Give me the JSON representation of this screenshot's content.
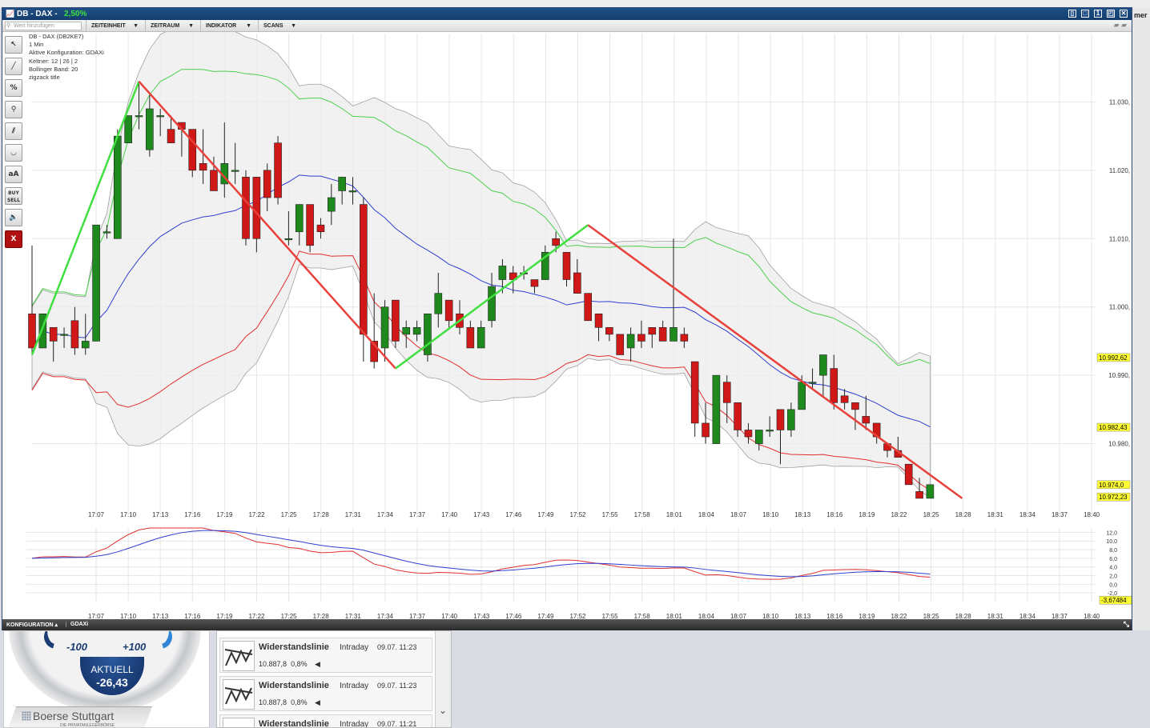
{
  "window": {
    "title": "DB - DAX -",
    "change": "2,50%",
    "accent": "#1f4f86"
  },
  "right_edge_text": "mer",
  "toolbar": {
    "search_placeholder": "Wert hinzufügen",
    "menus": [
      "ZEITEINHEIT",
      "ZEITRAUM",
      "INDIKATOR",
      "SCANS"
    ]
  },
  "tools": [
    "pointer-icon",
    "line-icon",
    "percent-icon",
    "zoom-icon",
    "parallel-lines-icon",
    "arc-icon",
    "text-icon",
    "buy-sell-icon",
    "sound-icon",
    "delete-icon"
  ],
  "tool_labels": [
    "↖",
    "╱",
    "%",
    "⚲",
    "⫽",
    "◡",
    "aA",
    "BUY SELL",
    "🔈",
    "X"
  ],
  "info": {
    "lines": [
      "DB - DAX (DB2KE7)",
      "1 Min",
      "Aktive Konfiguration: GDAXi",
      "Keltner: 12 | 26 | 2",
      "Bollinger Band: 20",
      "zigzack title"
    ]
  },
  "statusbar": {
    "config_label": "KONFIGURATION ▴",
    "config_name": "GDAXi"
  },
  "gauge": {
    "minus": "-100",
    "plus": "+100",
    "label": "AKTUELL",
    "value": "-26,43"
  },
  "logo": {
    "text": "Boerse Stuttgart",
    "sub": "DIE PRIVATANLEGERBÖRSE"
  },
  "signals": [
    {
      "title": "Widerstandslinie",
      "type": "Intraday",
      "date": "09.07. 11:23",
      "value": "10.887,8",
      "pct": "0,8%"
    },
    {
      "title": "Widerstandslinie",
      "type": "Intraday",
      "date": "09.07. 11:23",
      "value": "10.887,8",
      "pct": "0,8%"
    },
    {
      "title": "Widerstandslinie",
      "type": "Intraday",
      "date": "09.07. 11:21",
      "value": "",
      "pct": ""
    }
  ],
  "chart_data": {
    "type": "candlestick",
    "x_labels": [
      "17:07",
      "17:10",
      "17:13",
      "17:16",
      "17:19",
      "17:22",
      "17:25",
      "17:28",
      "17:31",
      "17:34",
      "17:37",
      "17:40",
      "17:43",
      "17:46",
      "17:49",
      "17:52",
      "17:55",
      "17:58",
      "18:01",
      "18:04",
      "18:07",
      "18:10",
      "18:13",
      "18:16",
      "18:19",
      "18:22",
      "18:25",
      "18:28",
      "18:31",
      "18:34",
      "18:37",
      "18:40"
    ],
    "y_ticks": [
      "11.030,",
      "11.020,",
      "11.010,",
      "11.000,",
      "10.990,",
      "10.980,"
    ],
    "y_range": [
      10970,
      11040
    ],
    "price_tags": [
      {
        "label": "10.992,62",
        "value": 10992.6,
        "color": "#ffff33"
      },
      {
        "label": "10.982,43",
        "value": 10982.4,
        "color": "#ffff33"
      },
      {
        "label": "10.974,0",
        "value": 10974.0,
        "color": "#ffff33"
      },
      {
        "label": "10.972,23",
        "value": 10972.2,
        "color": "#ffff33"
      }
    ],
    "ohlc": [
      [
        10999,
        11009,
        10993,
        10994
      ],
      [
        10994,
        10999,
        10994,
        10999
      ],
      [
        10997,
        10997,
        10992,
        10995
      ],
      [
        10996,
        10997,
        10994,
        10996
      ],
      [
        10998,
        11000,
        10993,
        10994
      ],
      [
        10994,
        10999,
        10993,
        10995
      ],
      [
        10995,
        11012,
        10995,
        11012
      ],
      [
        11011,
        11012,
        11010,
        11011
      ],
      [
        11010,
        11026,
        11010,
        11025
      ],
      [
        11024,
        11028,
        11024,
        11028
      ],
      [
        11028,
        11033,
        11026,
        11028
      ],
      [
        11023,
        11031,
        11022,
        11029
      ],
      [
        11028,
        11029,
        11025,
        11028
      ],
      [
        11026,
        11028,
        11024,
        11024
      ],
      [
        11027,
        11027,
        11022,
        11026
      ],
      [
        11026,
        11026,
        11019,
        11020
      ],
      [
        11021,
        11026,
        11018,
        11020
      ],
      [
        11020,
        11022,
        11017,
        11017
      ],
      [
        11018,
        11027,
        11016,
        11021
      ],
      [
        11020,
        11024,
        11018,
        11020
      ],
      [
        11019,
        11020,
        11009,
        11010
      ],
      [
        11019,
        11019,
        11008,
        11010
      ],
      [
        11020,
        11021,
        11014,
        11016
      ],
      [
        11024,
        11025,
        11015,
        11016
      ],
      [
        11010,
        11014,
        11009,
        11010
      ],
      [
        11011,
        11015,
        11009,
        11015
      ],
      [
        11015,
        11015,
        11008,
        11009
      ],
      [
        11012,
        11013,
        11010,
        11011
      ],
      [
        11014,
        11018,
        11012,
        11016
      ],
      [
        11017,
        11019,
        11015,
        11019
      ],
      [
        11017,
        11019,
        11015,
        11017
      ],
      [
        11015,
        11016,
        10992,
        10996
      ],
      [
        10995,
        11002,
        10991,
        10992
      ],
      [
        10994,
        11001,
        10992,
        11000
      ],
      [
        11001,
        11001,
        10994,
        10995
      ],
      [
        10996,
        10998,
        10994,
        10997
      ],
      [
        10996,
        10998,
        10995,
        10997
      ],
      [
        10993,
        10999,
        10992,
        10999
      ],
      [
        10999,
        11005,
        10997,
        11002
      ],
      [
        11001,
        11001,
        10997,
        10998
      ],
      [
        10999,
        11001,
        10996,
        10997
      ],
      [
        10997,
        10998,
        10994,
        10994
      ],
      [
        10994,
        10998,
        10994,
        10997
      ],
      [
        10998,
        11005,
        10997,
        11003
      ],
      [
        11004,
        11007,
        11002,
        11006
      ],
      [
        11005,
        11006,
        11002,
        11004
      ],
      [
        11005,
        11006,
        11004,
        11005
      ],
      [
        11004,
        11004,
        11002,
        11003
      ],
      [
        11004,
        11009,
        11004,
        11008
      ],
      [
        11010,
        11011,
        11008,
        11009
      ],
      [
        11008,
        11008,
        11003,
        11004
      ],
      [
        11005,
        11007,
        11002,
        11002
      ],
      [
        11002,
        11002,
        10998,
        10998
      ],
      [
        10999,
        10999,
        10995,
        10997
      ],
      [
        10997,
        10997,
        10995,
        10996
      ],
      [
        10996,
        10996,
        10993,
        10993
      ],
      [
        10994,
        10997,
        10992,
        10996
      ],
      [
        10996,
        10998,
        10994,
        10995
      ],
      [
        10997,
        10997,
        10994,
        10996
      ],
      [
        10997,
        10998,
        10995,
        10995
      ],
      [
        10995,
        11010,
        10995,
        10997
      ],
      [
        10996,
        10997,
        10994,
        10995
      ],
      [
        10992,
        10992,
        10981,
        10983
      ],
      [
        10983,
        10986,
        10980,
        10981
      ],
      [
        10980,
        10990,
        10980,
        10990
      ],
      [
        10989,
        10990,
        10983,
        10986
      ],
      [
        10986,
        10986,
        10981,
        10982
      ],
      [
        10982,
        10983,
        10980,
        10981
      ],
      [
        10980,
        10982,
        10979,
        10982
      ],
      [
        10982,
        10984,
        10981,
        10982
      ],
      [
        10985,
        10985,
        10977,
        10982
      ],
      [
        10982,
        10986,
        10981,
        10985
      ],
      [
        10985,
        10990,
        10985,
        10989
      ],
      [
        10989,
        10991,
        10988,
        10989
      ],
      [
        10990,
        10993,
        10987,
        10993
      ],
      [
        10991,
        10993,
        10985,
        10986
      ],
      [
        10987,
        10988,
        10985,
        10986
      ],
      [
        10986,
        10986,
        10982,
        10985
      ],
      [
        10984,
        10987,
        10982,
        10983
      ],
      [
        10983,
        10983,
        10980,
        10981
      ],
      [
        10980,
        10980,
        10978,
        10979
      ],
      [
        10979,
        10981,
        10978,
        10978
      ],
      [
        10977,
        10977,
        10974,
        10974
      ],
      [
        10973,
        10975,
        10972,
        10972
      ],
      [
        10972,
        10974,
        10972,
        10974
      ]
    ],
    "zigzag": [
      [
        10993,
        10993
      ],
      [
        11009,
        11033
      ],
      [
        11033,
        10991
      ],
      [
        10991,
        11012
      ],
      [
        11012,
        10972
      ]
    ],
    "macd_ticks": [
      "12,0",
      "10,0",
      "8,0",
      "6,0",
      "4,0",
      "2,0",
      "0,0",
      "-2,0"
    ],
    "macd_tag": {
      "label": "-3,67484",
      "color": "#ffff33"
    },
    "macd_range": [
      -4,
      13
    ]
  }
}
